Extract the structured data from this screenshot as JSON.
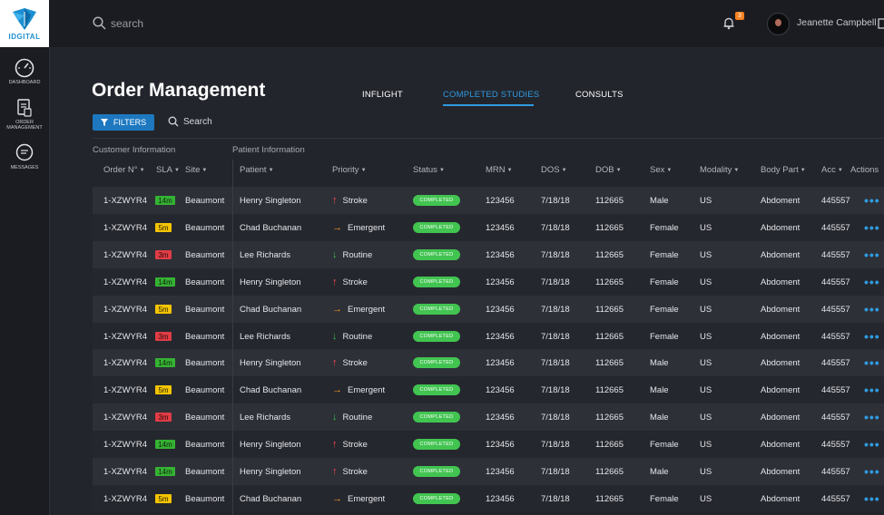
{
  "brand": {
    "logo_text": "IDGITAL"
  },
  "sidebar": {
    "items": [
      {
        "label": "DASHBOARD"
      },
      {
        "label": "ORDER MANAGEMENT"
      },
      {
        "label": "MESSAGES"
      }
    ]
  },
  "header": {
    "search_placeholder": "search",
    "notification_count": "3",
    "user_name": "Jeanette Campbell"
  },
  "page": {
    "title": "Order Management",
    "tabs": [
      {
        "label": "INFLIGHT",
        "active": false
      },
      {
        "label": "COMPLETED STUDIES",
        "active": true
      },
      {
        "label": "CONSULTS",
        "active": false
      }
    ],
    "filters_label": "FILTERS",
    "search_label": "Search",
    "group_customer": "Customer Information",
    "group_patient": "Patient Information"
  },
  "colors": {
    "accent": "#2e9be0",
    "sla_green": "#35b233",
    "sla_yellow": "#f5c400",
    "sla_red": "#e03c46",
    "status_green": "#42c451"
  },
  "table": {
    "columns": [
      "Order N°",
      "SLA",
      "Site",
      "Patient",
      "Priority",
      "Status",
      "MRN",
      "DOS",
      "DOB",
      "Sex",
      "Modality",
      "Body Part",
      "Acc",
      "Actions"
    ],
    "rows": [
      {
        "order": "1-XZWYR4",
        "sla": "14m",
        "sla_level": "g",
        "site": "Beaumont",
        "patient": "Henry Singleton",
        "priority": "Stroke",
        "priority_icon": "up",
        "status": "COMPLETED",
        "mrn": "123456",
        "dos": "7/18/18",
        "dob": "112665",
        "sex": "Male",
        "modality": "US",
        "body_part": "Abdoment",
        "acc": "445557"
      },
      {
        "order": "1-XZWYR4",
        "sla": "5m",
        "sla_level": "y",
        "site": "Beaumont",
        "patient": "Chad Buchanan",
        "priority": "Emergent",
        "priority_icon": "right",
        "status": "COMPLETED",
        "mrn": "123456",
        "dos": "7/18/18",
        "dob": "112665",
        "sex": "Female",
        "modality": "US",
        "body_part": "Abdoment",
        "acc": "445557"
      },
      {
        "order": "1-XZWYR4",
        "sla": "3m",
        "sla_level": "r",
        "site": "Beaumont",
        "patient": "Lee Richards",
        "priority": "Routine",
        "priority_icon": "down",
        "status": "COMPLETED",
        "mrn": "123456",
        "dos": "7/18/18",
        "dob": "112665",
        "sex": "Female",
        "modality": "US",
        "body_part": "Abdoment",
        "acc": "445557"
      },
      {
        "order": "1-XZWYR4",
        "sla": "14m",
        "sla_level": "g",
        "site": "Beaumont",
        "patient": "Henry Singleton",
        "priority": "Stroke",
        "priority_icon": "up",
        "status": "COMPLETED",
        "mrn": "123456",
        "dos": "7/18/18",
        "dob": "112665",
        "sex": "Female",
        "modality": "US",
        "body_part": "Abdoment",
        "acc": "445557"
      },
      {
        "order": "1-XZWYR4",
        "sla": "5m",
        "sla_level": "y",
        "site": "Beaumont",
        "patient": "Chad Buchanan",
        "priority": "Emergent",
        "priority_icon": "right",
        "status": "COMPLETED",
        "mrn": "123456",
        "dos": "7/18/18",
        "dob": "112665",
        "sex": "Female",
        "modality": "US",
        "body_part": "Abdoment",
        "acc": "445557"
      },
      {
        "order": "1-XZWYR4",
        "sla": "3m",
        "sla_level": "r",
        "site": "Beaumont",
        "patient": "Lee Richards",
        "priority": "Routine",
        "priority_icon": "down",
        "status": "COMPLETED",
        "mrn": "123456",
        "dos": "7/18/18",
        "dob": "112665",
        "sex": "Female",
        "modality": "US",
        "body_part": "Abdoment",
        "acc": "445557"
      },
      {
        "order": "1-XZWYR4",
        "sla": "14m",
        "sla_level": "g",
        "site": "Beaumont",
        "patient": "Henry Singleton",
        "priority": "Stroke",
        "priority_icon": "up",
        "status": "COMPLETED",
        "mrn": "123456",
        "dos": "7/18/18",
        "dob": "112665",
        "sex": "Male",
        "modality": "US",
        "body_part": "Abdoment",
        "acc": "445557"
      },
      {
        "order": "1-XZWYR4",
        "sla": "5m",
        "sla_level": "y",
        "site": "Beaumont",
        "patient": "Chad Buchanan",
        "priority": "Emergent",
        "priority_icon": "right",
        "status": "COMPLETED",
        "mrn": "123456",
        "dos": "7/18/18",
        "dob": "112665",
        "sex": "Male",
        "modality": "US",
        "body_part": "Abdoment",
        "acc": "445557"
      },
      {
        "order": "1-XZWYR4",
        "sla": "3m",
        "sla_level": "r",
        "site": "Beaumont",
        "patient": "Lee Richards",
        "priority": "Routine",
        "priority_icon": "down",
        "status": "COMPLETED",
        "mrn": "123456",
        "dos": "7/18/18",
        "dob": "112665",
        "sex": "Male",
        "modality": "US",
        "body_part": "Abdoment",
        "acc": "445557"
      },
      {
        "order": "1-XZWYR4",
        "sla": "14m",
        "sla_level": "g",
        "site": "Beaumont",
        "patient": "Henry Singleton",
        "priority": "Stroke",
        "priority_icon": "up",
        "status": "COMPLETED",
        "mrn": "123456",
        "dos": "7/18/18",
        "dob": "112665",
        "sex": "Female",
        "modality": "US",
        "body_part": "Abdoment",
        "acc": "445557"
      },
      {
        "order": "1-XZWYR4",
        "sla": "14m",
        "sla_level": "g",
        "site": "Beaumont",
        "patient": "Henry Singleton",
        "priority": "Stroke",
        "priority_icon": "up",
        "status": "COMPLETED",
        "mrn": "123456",
        "dos": "7/18/18",
        "dob": "112665",
        "sex": "Male",
        "modality": "US",
        "body_part": "Abdoment",
        "acc": "445557"
      },
      {
        "order": "1-XZWYR4",
        "sla": "5m",
        "sla_level": "y",
        "site": "Beaumont",
        "patient": "Chad Buchanan",
        "priority": "Emergent",
        "priority_icon": "right",
        "status": "COMPLETED",
        "mrn": "123456",
        "dos": "7/18/18",
        "dob": "112665",
        "sex": "Female",
        "modality": "US",
        "body_part": "Abdoment",
        "acc": "445557"
      }
    ]
  }
}
